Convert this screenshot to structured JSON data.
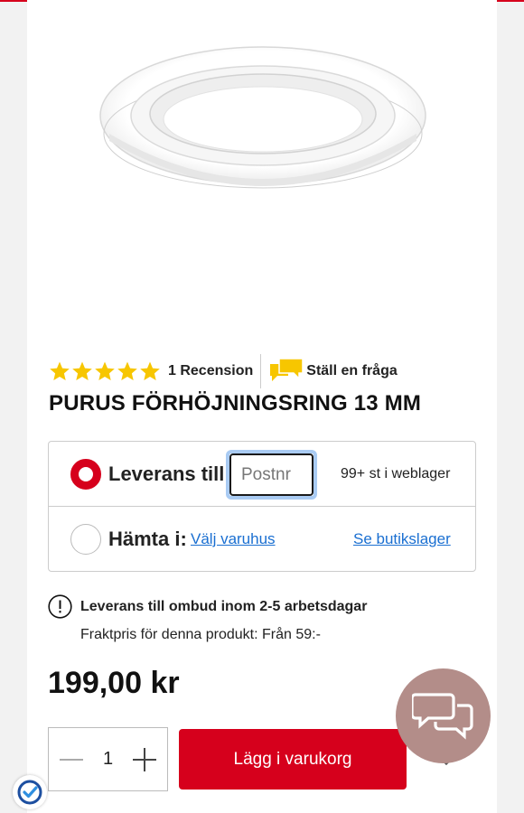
{
  "colors": {
    "brand_red": "#d6001c",
    "link_blue": "#1a6fd1",
    "star_yellow": "#f7c600",
    "chat_bubble": "#b38d89"
  },
  "product": {
    "image_icon": "drain-ring-image",
    "rating": 5,
    "rating_max": 5,
    "review_count": "1 Recension",
    "ask_question": "Ställ en fråga",
    "title": "PURUS FÖRHÖJNINGSRING 13 MM"
  },
  "delivery": {
    "option_delivery": {
      "label": "Leverans till:",
      "selected": true,
      "postcode_placeholder": "Postnr",
      "postcode_value": "",
      "stock": "99+ st i weblager"
    },
    "option_pickup": {
      "label": "Hämta i:",
      "selected": false,
      "choose_store": "Välj varuhus",
      "see_store_stock": "Se butikslager"
    }
  },
  "info": {
    "icon": "info-icon",
    "title": "Leverans till ombud inom 2-5 arbetsdagar",
    "shipping_price": "Fraktpris för denna produkt: Från 59:-"
  },
  "price": "199,00 kr",
  "cart": {
    "quantity": "1",
    "add_button": "Lägg i varukorg"
  },
  "floating": {
    "chat_icon": "chat-bubbles-icon",
    "trust_badge_icon": "checkmark-shield-icon"
  }
}
